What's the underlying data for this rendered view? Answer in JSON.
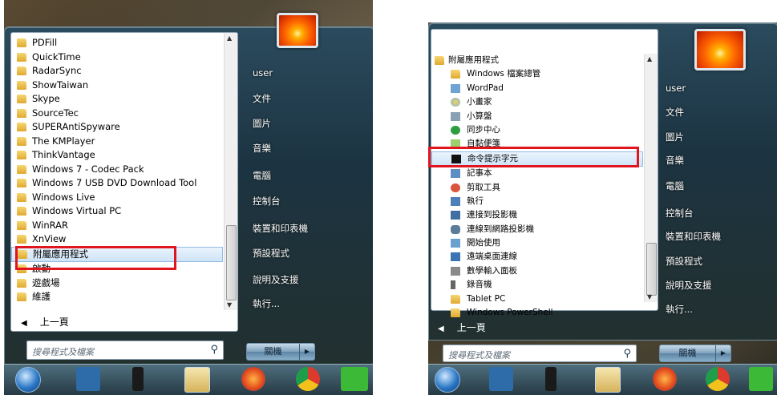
{
  "left_menu": {
    "items": [
      {
        "label": "PDFill",
        "icon": "folder-icon"
      },
      {
        "label": "QuickTime",
        "icon": "folder-icon"
      },
      {
        "label": "RadarSync",
        "icon": "folder-icon"
      },
      {
        "label": "ShowTaiwan",
        "icon": "folder-icon"
      },
      {
        "label": "Skype",
        "icon": "folder-icon"
      },
      {
        "label": "SourceTec",
        "icon": "folder-icon"
      },
      {
        "label": "SUPERAntiSpyware",
        "icon": "folder-icon"
      },
      {
        "label": "The KMPlayer",
        "icon": "folder-icon"
      },
      {
        "label": "ThinkVantage",
        "icon": "folder-icon"
      },
      {
        "label": "Windows 7 - Codec Pack",
        "icon": "folder-icon"
      },
      {
        "label": "Windows 7 USB DVD Download Tool",
        "icon": "folder-icon"
      },
      {
        "label": "Windows Live",
        "icon": "folder-icon"
      },
      {
        "label": "Windows Virtual PC",
        "icon": "folder-icon"
      },
      {
        "label": "WinRAR",
        "icon": "folder-icon"
      },
      {
        "label": "XnView",
        "icon": "folder-icon"
      },
      {
        "label": "附屬應用程式",
        "icon": "folder-icon"
      },
      {
        "label": "啟動",
        "icon": "folder-icon"
      },
      {
        "label": "遊戲場",
        "icon": "folder-icon"
      },
      {
        "label": "維護",
        "icon": "folder-icon"
      }
    ],
    "highlighted_index": 15,
    "back_label": "上一頁",
    "search_placeholder": "搜尋程式及檔案"
  },
  "right_menu": {
    "items": [
      {
        "label": "附屬應用程式",
        "icon": "folder-icon"
      },
      {
        "label": "Windows 檔案總管",
        "icon": "explorer-icon"
      },
      {
        "label": "WordPad",
        "icon": "wordpad-icon"
      },
      {
        "label": "小畫家",
        "icon": "paint-icon"
      },
      {
        "label": "小算盤",
        "icon": "calculator-icon"
      },
      {
        "label": "同步中心",
        "icon": "sync-icon"
      },
      {
        "label": "自黏便箋",
        "icon": "sticky-note-icon"
      },
      {
        "label": "命令提示字元",
        "icon": "cmd-icon"
      },
      {
        "label": "記事本",
        "icon": "notepad-icon"
      },
      {
        "label": "剪取工具",
        "icon": "snipping-icon"
      },
      {
        "label": "執行",
        "icon": "run-icon"
      },
      {
        "label": "連接到投影機",
        "icon": "projector-icon"
      },
      {
        "label": "連線到網路投影機",
        "icon": "network-projector-icon"
      },
      {
        "label": "開始使用",
        "icon": "getting-started-icon"
      },
      {
        "label": "遠端桌面連線",
        "icon": "remote-desktop-icon"
      },
      {
        "label": "數學輸入面板",
        "icon": "math-input-icon"
      },
      {
        "label": "錄音機",
        "icon": "sound-recorder-icon"
      },
      {
        "label": "Tablet PC",
        "icon": "folder-icon"
      },
      {
        "label": "Windows PowerShell",
        "icon": "folder-icon"
      }
    ],
    "highlighted_index": 7,
    "back_label": "上一頁",
    "search_placeholder": "搜尋程式及檔案"
  },
  "places": [
    "user",
    "文件",
    "圖片",
    "音樂",
    "電腦",
    "控制台",
    "裝置和印表機",
    "預設程式",
    "說明及支援",
    "執行..."
  ],
  "shutdown_label": "關機",
  "colors": {
    "highlight_box": "#e0151e",
    "menu_border": "#8da2b5",
    "taskbar": "#263a44"
  }
}
